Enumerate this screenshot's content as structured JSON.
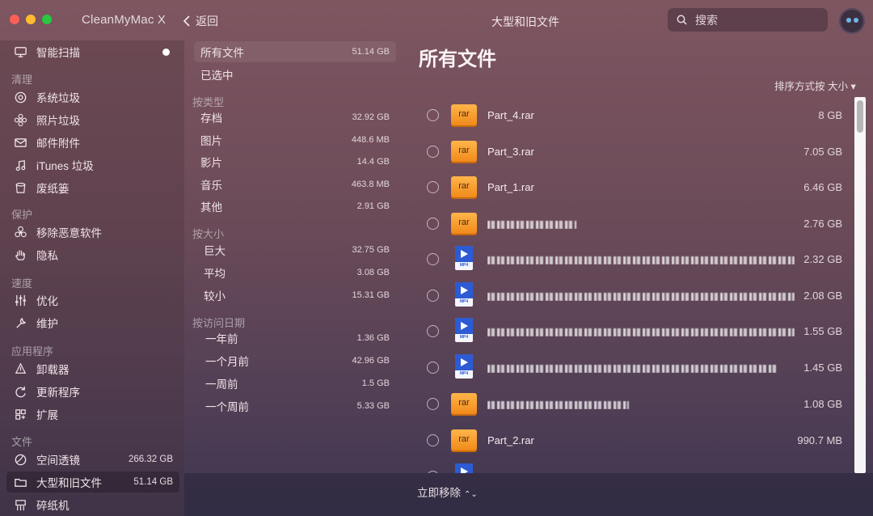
{
  "window": {
    "title": "CleanMyMac X"
  },
  "nav": {
    "back_label": "返回",
    "center_title": "大型和旧文件"
  },
  "search": {
    "placeholder": "搜索"
  },
  "sidebar": {
    "smart_scan": "智能扫描",
    "sections": {
      "cleanup": "清理",
      "protection": "保护",
      "speed": "速度",
      "apps": "应用程序",
      "files": "文件"
    },
    "items": [
      {
        "label": "系统垃圾"
      },
      {
        "label": "照片垃圾"
      },
      {
        "label": "邮件附件"
      },
      {
        "label": "iTunes 垃圾"
      },
      {
        "label": "废纸篓"
      },
      {
        "label": "移除恶意软件"
      },
      {
        "label": "隐私"
      },
      {
        "label": "优化"
      },
      {
        "label": "维护"
      },
      {
        "label": "卸载器"
      },
      {
        "label": "更新程序"
      },
      {
        "label": "扩展"
      },
      {
        "label": "空间透镜",
        "size": "266.32 GB"
      },
      {
        "label": "大型和旧文件",
        "size": "51.14 GB"
      },
      {
        "label": "碎纸机"
      }
    ]
  },
  "filters": {
    "all": {
      "label": "所有文件",
      "value": "51.14 GB"
    },
    "selected": {
      "label": "已选中"
    },
    "by_type": {
      "heading": "按类型",
      "items": [
        {
          "label": "存档",
          "value": "32.92 GB"
        },
        {
          "label": "图片",
          "value": "448.6 MB"
        },
        {
          "label": "影片",
          "value": "14.4 GB"
        },
        {
          "label": "音乐",
          "value": "463.8 MB"
        },
        {
          "label": "其他",
          "value": "2.91 GB"
        }
      ]
    },
    "by_size": {
      "heading": "按大小",
      "items": [
        {
          "label": "巨大",
          "value": "32.75 GB"
        },
        {
          "label": "平均",
          "value": "3.08 GB"
        },
        {
          "label": "较小",
          "value": "15.31 GB"
        }
      ]
    },
    "by_date": {
      "heading": "按访问日期",
      "items": [
        {
          "label": "一年前",
          "value": "1.36 GB"
        },
        {
          "label": "一个月前",
          "value": "42.96 GB"
        },
        {
          "label": "一周前",
          "value": "1.5 GB"
        },
        {
          "label": "一个周前",
          "value": "5.33 GB"
        }
      ]
    }
  },
  "main": {
    "title": "所有文件",
    "sort_label": "排序方式按 大小 ▾",
    "files": [
      {
        "name": "Part_4.rar",
        "size": "8 GB",
        "icon": "rar"
      },
      {
        "name": "Part_3.rar",
        "size": "7.05 GB",
        "icon": "rar"
      },
      {
        "name": "Part_1.rar",
        "size": "6.46 GB",
        "icon": "rar"
      },
      {
        "name": "",
        "size": "2.76 GB",
        "icon": "rar"
      },
      {
        "name": "",
        "size": "2.32 GB",
        "icon": "mp4"
      },
      {
        "name": "",
        "size": "2.08 GB",
        "icon": "mp4"
      },
      {
        "name": "",
        "size": "1.55 GB",
        "icon": "mp4"
      },
      {
        "name": "",
        "size": "1.45 GB",
        "icon": "mp4"
      },
      {
        "name": "",
        "size": "1.08 GB",
        "icon": "rar"
      },
      {
        "name": "Part_2.rar",
        "size": "990.7 MB",
        "icon": "rar"
      }
    ],
    "rar_badge": "rar",
    "mp4_badge": "MP4"
  },
  "footer": {
    "remove_label": "立即移除"
  },
  "colors": {
    "traffic_close": "#fe5f57",
    "traffic_min": "#febc2e",
    "traffic_max": "#28c840",
    "rar": "#f59a24",
    "mp4": "#2c5bd3"
  }
}
